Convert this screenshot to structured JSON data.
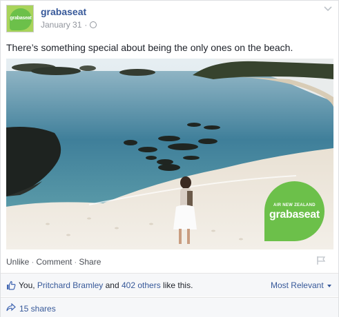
{
  "post": {
    "author": "grabaseat",
    "date": "January 31",
    "dot": "·",
    "privacy_icon": "globe-icon",
    "text": "There’s something special about being the only ones on the beach."
  },
  "avatar": {
    "logo_text": "grabaseat"
  },
  "photo": {
    "badge_small": "AIR NEW ZEALAND",
    "badge_big": "grabaseat",
    "badge_color": "#6cc04a"
  },
  "actions": {
    "unlike": "Unlike",
    "comment": "Comment",
    "share": "Share",
    "sep": "·"
  },
  "likes": {
    "prefix": "You, ",
    "friend": "Pritchard Bramley",
    "middle": " and ",
    "others": "402 others",
    "suffix": " like this."
  },
  "sort": {
    "label": "Most Relevant"
  },
  "shares": {
    "label": "15 shares"
  },
  "colors": {
    "link": "#365899",
    "meta": "#90949c"
  }
}
